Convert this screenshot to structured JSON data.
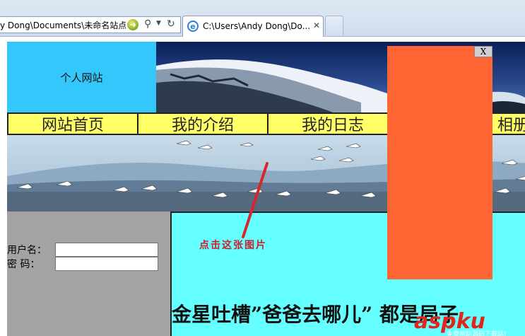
{
  "browser": {
    "address_text": "y Dong\\Documents\\未命名站点",
    "tab_title": "C:\\Users\\Andy Dong\\Do...",
    "tab_close": "✕",
    "tab_icon": "e"
  },
  "site": {
    "logo_text": "个人网站",
    "nav": [
      {
        "label": "网站首页"
      },
      {
        "label": "我的介绍"
      },
      {
        "label": "我的日志"
      },
      {
        "label": "相册"
      }
    ]
  },
  "login": {
    "username_label": "用户名：",
    "password_label": "密  码：",
    "username_value": "",
    "password_value": ""
  },
  "annotation": {
    "text": "点击这张图片"
  },
  "content": {
    "headline": "金星吐槽”爸爸去哪儿” 都是局子"
  },
  "popup": {
    "close_label": "X"
  },
  "watermark": {
    "main": "aspku",
    "sub": "免费网站源码下载站!"
  },
  "colors": {
    "logo_bg": "#33c7fb",
    "nav_bg": "#ffff66",
    "sidebar_bg": "#a3a3a3",
    "content_bg": "#66ffff",
    "popup_bg": "#ff6633",
    "annotation": "#c8222e"
  }
}
